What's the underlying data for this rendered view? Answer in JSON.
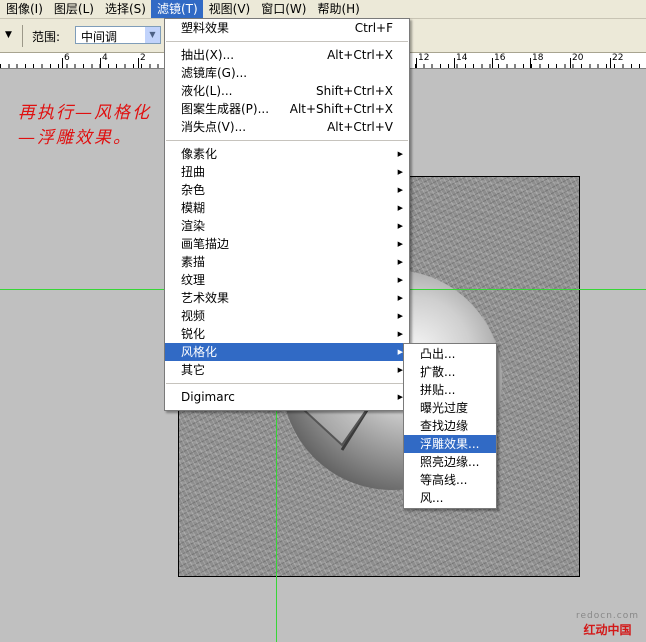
{
  "menubar": {
    "items": [
      "图像(I)",
      "图层(L)",
      "选择(S)",
      "滤镜(T)",
      "视图(V)",
      "窗口(W)",
      "帮助(H)"
    ],
    "active_index": 3
  },
  "options": {
    "range_label": "范围:",
    "range_value": "中间调"
  },
  "ruler": {
    "top_labels": [
      "2",
      "4",
      "6",
      "12",
      "14",
      "16",
      "18",
      "20",
      "22"
    ]
  },
  "annotation": {
    "text": "再执行—风格化—浮雕效果。"
  },
  "filter_menu": {
    "group1": [
      {
        "label": "塑料效果",
        "shortcut": "Ctrl+F"
      }
    ],
    "group2": [
      {
        "label": "抽出(X)...",
        "shortcut": "Alt+Ctrl+X"
      },
      {
        "label": "滤镜库(G)...",
        "shortcut": ""
      },
      {
        "label": "液化(L)...",
        "shortcut": "Shift+Ctrl+X"
      },
      {
        "label": "图案生成器(P)...",
        "shortcut": "Alt+Shift+Ctrl+X"
      },
      {
        "label": "消失点(V)...",
        "shortcut": "Alt+Ctrl+V"
      }
    ],
    "group3": [
      "像素化",
      "扭曲",
      "杂色",
      "模糊",
      "渲染",
      "画笔描边",
      "素描",
      "纹理",
      "艺术效果",
      "视频",
      "锐化",
      "风格化",
      "其它"
    ],
    "highlighted": "风格化",
    "group4": [
      "Digimarc"
    ]
  },
  "stylize_submenu": {
    "items": [
      "凸出...",
      "扩散...",
      "拼贴...",
      "曝光过度",
      "查找边缘",
      "浮雕效果...",
      "照亮边缘...",
      "等高线...",
      "风..."
    ],
    "highlighted": "浮雕效果..."
  },
  "watermark": {
    "url": "redocn.com",
    "name": "红动中国"
  }
}
